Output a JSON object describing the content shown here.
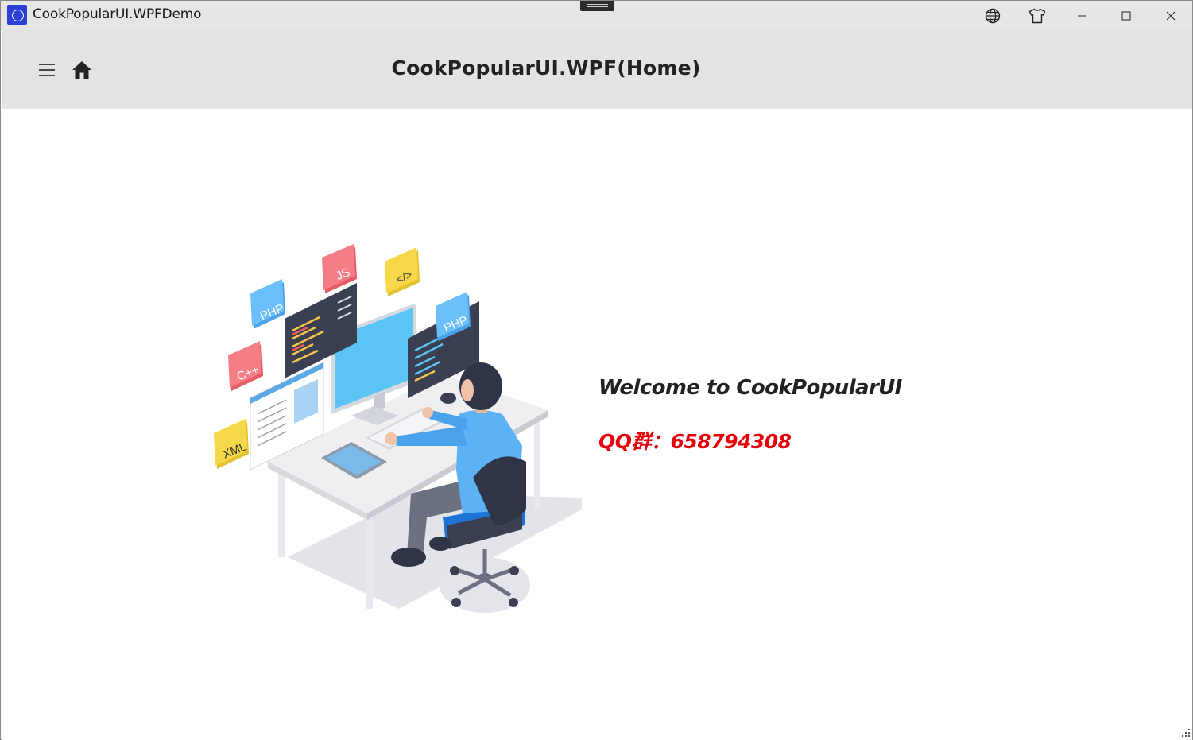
{
  "window": {
    "title": "CookPopularUI.WPFDemo",
    "buttons": {
      "language": "globe-icon",
      "theme": "tshirt-icon",
      "minimize": "minimize-icon",
      "maximize": "maximize-icon",
      "close": "close-icon"
    }
  },
  "header": {
    "title": "CookPopularUI.WPF(Home)",
    "menu_icon": "hamburger-menu-icon",
    "home_icon": "home-icon",
    "background": "#e3e3e3"
  },
  "main": {
    "welcome_text": "Welcome to CookPopularUI",
    "qq_text": "QQ群：658794308",
    "qq_color": "#e8000b",
    "illustration": {
      "badges": [
        "PHP",
        "JS",
        "</>",
        "PHP",
        "C++",
        "XML"
      ]
    }
  }
}
